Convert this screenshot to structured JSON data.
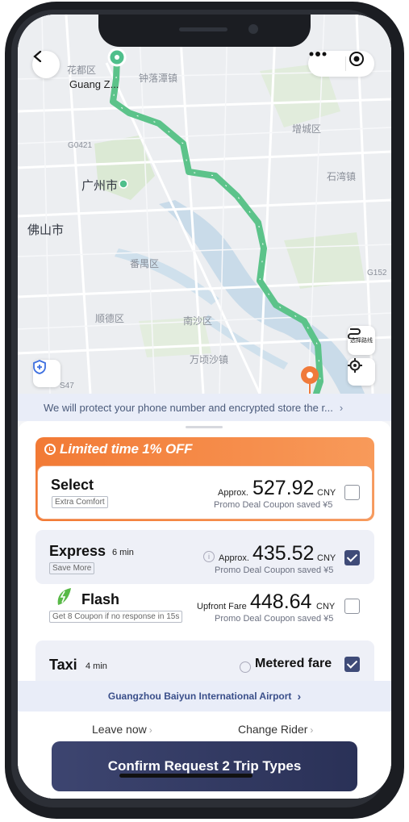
{
  "map": {
    "labels": {
      "huadu": "花都区",
      "guang": "Guang Z...",
      "zhongluotan": "钟落潭镇",
      "zengcheng": "增城区",
      "g0421": "G0421",
      "guangzhou": "广州市",
      "shiwan": "石湾镇",
      "foshan": "佛山市",
      "panyu": "番禺区",
      "g152": "G152",
      "shunde": "顺德区",
      "nansha": "南沙区",
      "wanqingsha": "万顷沙镇",
      "s47": "S47"
    },
    "route_button_label": "选择路线",
    "colors": {
      "route": "#5cc38a",
      "destination": "#f07a3a",
      "origin": "#4fbf8b"
    }
  },
  "notice": {
    "text": "We will protect your phone number and encrypted store the r..."
  },
  "promo": {
    "title": "Limited time 1% OFF"
  },
  "options": [
    {
      "name": "Select",
      "tag": "Extra Comfort",
      "eta": "",
      "approx": "Approx.",
      "price": "527.92",
      "currency": "CNY",
      "saved": "Promo Deal Coupon saved ¥5",
      "checked": false
    },
    {
      "name": "Express",
      "tag": "Save More",
      "eta": "6 min",
      "approx": "Approx.",
      "price": "435.52",
      "currency": "CNY",
      "saved": "Promo Deal Coupon saved ¥5",
      "checked": true
    },
    {
      "name": "Flash",
      "tag": "Get 8 Coupon if no response in 15s",
      "eta": "",
      "approx": "Upfront Fare",
      "price": "448.64",
      "currency": "CNY",
      "saved": "Promo Deal Coupon saved ¥5",
      "checked": false
    },
    {
      "name": "Taxi",
      "eta": "4 min",
      "approx": "Metered fare",
      "checked": true
    }
  ],
  "airport": {
    "label": "Guangzhou Baiyun International Airport"
  },
  "actions": {
    "leave_now": "Leave now",
    "change_rider": "Change Rider",
    "confirm": "Confirm Request 2 Trip Types"
  }
}
